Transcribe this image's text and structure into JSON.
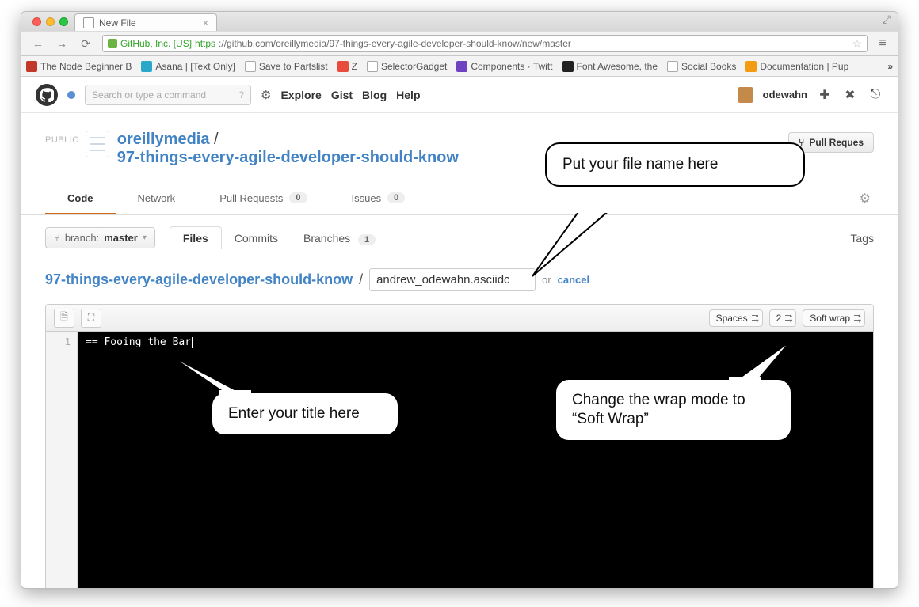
{
  "browser": {
    "tab_title": "New File",
    "ev_issuer": "GitHub, Inc. [US]",
    "url_scheme": "https",
    "url_rest": "://github.com/oreillymedia/97-things-every-agile-developer-should-know/new/master",
    "bookmarks": [
      "The Node Beginner B",
      "Asana | [Text Only]",
      "Save to Partslist",
      "Z",
      "SelectorGadget",
      "Components · Twitt",
      "Font Awesome, the",
      "Social Books",
      "Documentation | Pup"
    ]
  },
  "github": {
    "search_placeholder": "Search or type a command",
    "top_links": [
      "Explore",
      "Gist",
      "Blog",
      "Help"
    ],
    "username": "odewahn",
    "public_label": "PUBLIC",
    "owner": "oreillymedia",
    "repo_name": "97-things-every-agile-developer-should-know",
    "pull_request_btn": "Pull Reques",
    "tabs": {
      "code": "Code",
      "network": "Network",
      "pulls": "Pull Requests",
      "pulls_count": "0",
      "issues": "Issues",
      "issues_count": "0"
    },
    "branch_prefix": "branch:",
    "branch_name": "master",
    "subtabs": {
      "files": "Files",
      "commits": "Commits",
      "branches": "Branches",
      "branches_count": "1",
      "tags": "Tags"
    },
    "breadcrumb_repo": "97-things-every-agile-developer-should-know",
    "filename_value": "andrew_odewahn.asciidc",
    "or_text": "or",
    "cancel_text": "cancel",
    "editor_selects": {
      "indent_mode": "Spaces",
      "indent_size": "2",
      "wrap_mode": "Soft wrap"
    },
    "gutter_line": "1",
    "code_line": "== Fooing the Bar"
  },
  "callouts": {
    "filename": "Put your file name here",
    "title": "Enter your title here",
    "wrap": "Change the wrap mode to “Soft Wrap”"
  }
}
